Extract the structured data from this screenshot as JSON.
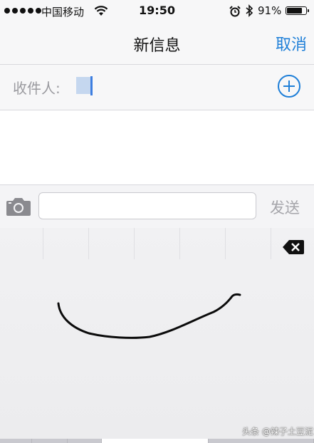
{
  "status_bar": {
    "carrier": "中国移动",
    "time": "19:50",
    "battery_percent": "91%",
    "battery_level": 0.91
  },
  "nav": {
    "title": "新信息",
    "cancel_label": "取消"
  },
  "recipient": {
    "label": "收件人:",
    "add_icon": "plus-circle-icon"
  },
  "compose": {
    "camera_icon": "camera-icon",
    "message_value": "",
    "send_label": "发送"
  },
  "handwriting": {
    "delete_icon": "backspace-icon"
  },
  "watermark": "头条 @辣子土豆泥",
  "colors": {
    "accent": "#1e7fd8",
    "send_disabled": "#a5a5aa"
  }
}
